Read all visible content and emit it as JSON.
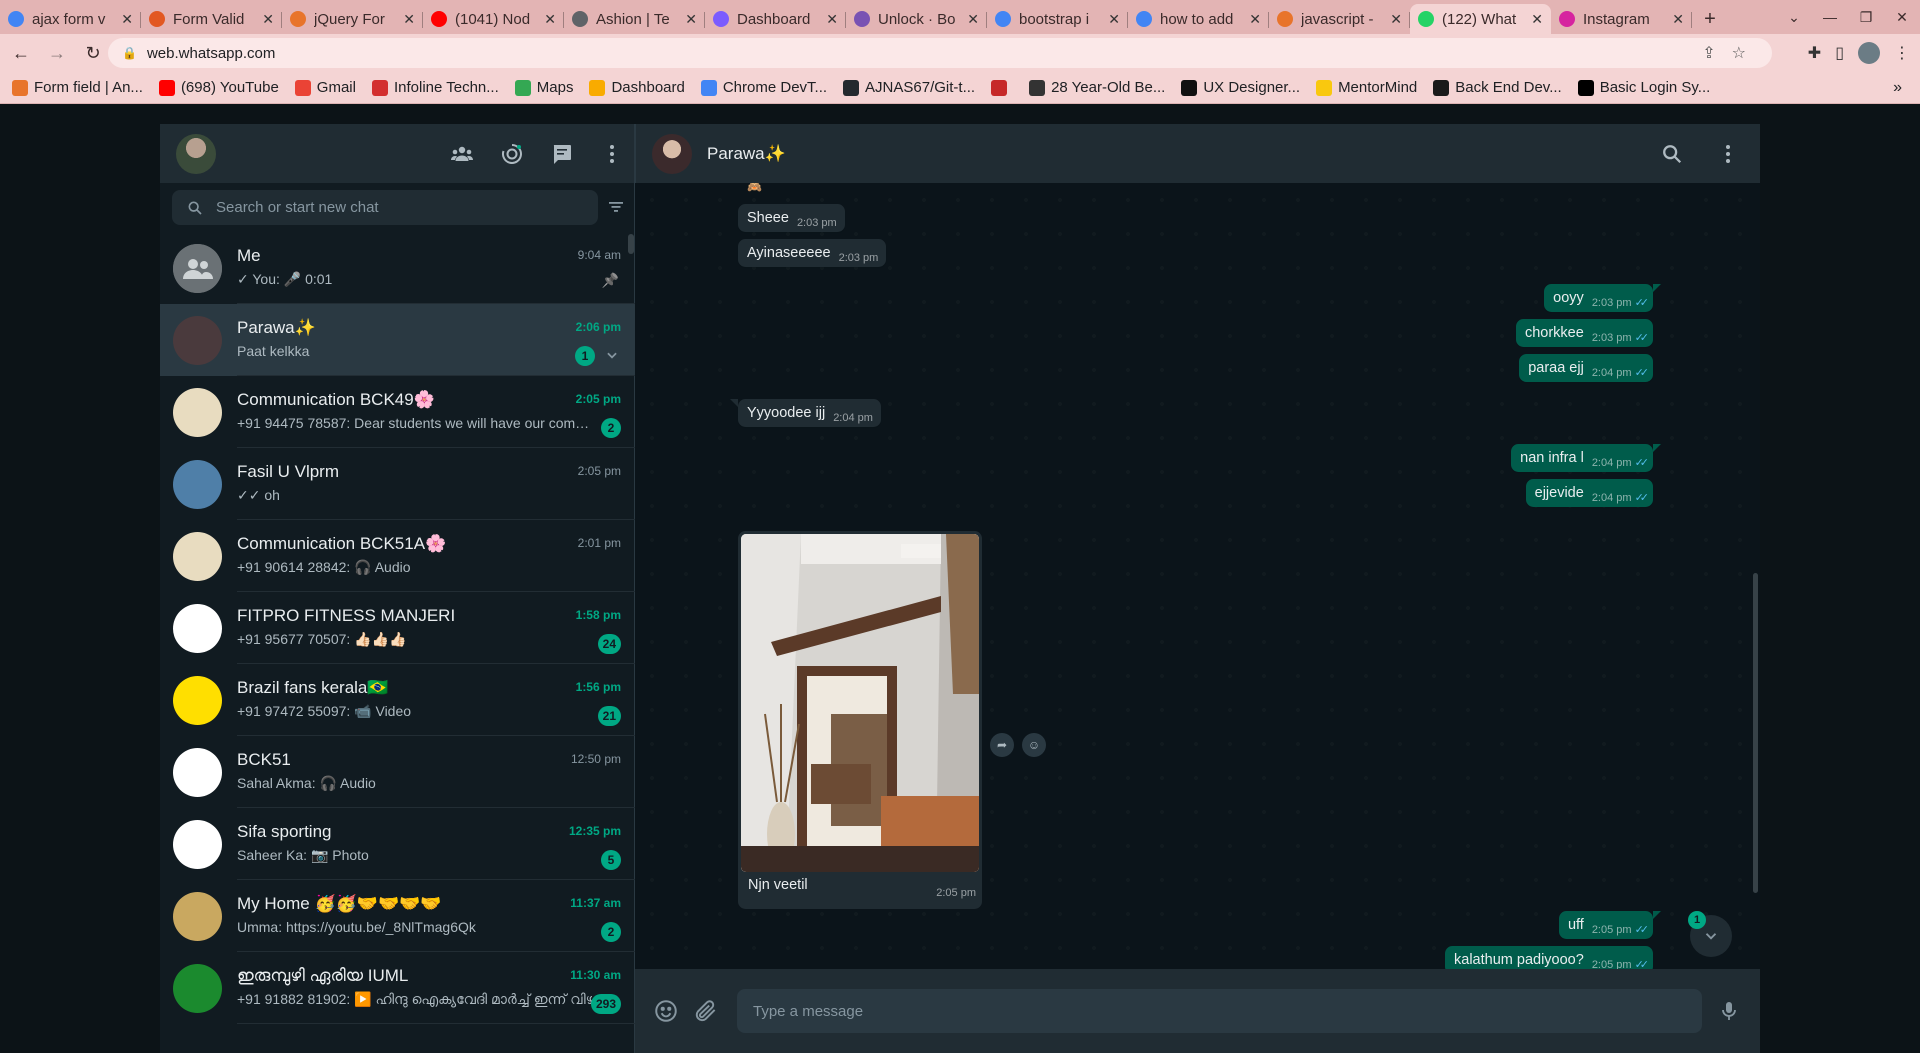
{
  "browser": {
    "tabs": [
      {
        "title": "ajax form v",
        "icon": "google-icon",
        "color": "#4285f4"
      },
      {
        "title": "Form Valid",
        "icon": "flame-icon",
        "color": "#e25822"
      },
      {
        "title": "jQuery For",
        "icon": "flame-icon",
        "color": "#e8742b"
      },
      {
        "title": "(1041) Nod",
        "icon": "youtube-icon",
        "color": "#ff0000"
      },
      {
        "title": "Ashion | Te",
        "icon": "globe-icon",
        "color": "#5f6368"
      },
      {
        "title": "Dashboard",
        "icon": "dashboard-icon",
        "color": "#7b5cff"
      },
      {
        "title": "Unlock · Bo",
        "icon": "bootstrap-icon",
        "color": "#7952b3"
      },
      {
        "title": "bootstrap i",
        "icon": "google-icon",
        "color": "#4285f4"
      },
      {
        "title": "how to add",
        "icon": "google-icon",
        "color": "#4285f4"
      },
      {
        "title": "javascript -",
        "icon": "flame-icon",
        "color": "#e8742b"
      },
      {
        "title": "(122) What",
        "icon": "whatsapp-icon",
        "color": "#25d366"
      },
      {
        "title": "Instagram",
        "icon": "instagram-icon",
        "color": "#d6249f"
      }
    ],
    "url": "web.whatsapp.com",
    "bookmarks": [
      {
        "label": "Form field | An...",
        "color": "#e8742b"
      },
      {
        "label": "(698) YouTube",
        "color": "#ff0000"
      },
      {
        "label": "Gmail",
        "color": "#ea4335"
      },
      {
        "label": "Infoline Techn...",
        "color": "#d32f2f"
      },
      {
        "label": "Maps",
        "color": "#34a853"
      },
      {
        "label": "Dashboard",
        "color": "#f9ab00"
      },
      {
        "label": "Chrome DevT...",
        "color": "#4285f4"
      },
      {
        "label": "AJNAS67/Git-t...",
        "color": "#24292e"
      },
      {
        "label": "",
        "color": "#c62828"
      },
      {
        "label": "28 Year-Old Be...",
        "color": "#333333"
      },
      {
        "label": "UX Designer...",
        "color": "#111111"
      },
      {
        "label": "MentorMind",
        "color": "#f9c80e"
      },
      {
        "label": "Back End Dev...",
        "color": "#1a1a1a"
      },
      {
        "label": "Basic Login Sy...",
        "color": "#000000"
      }
    ]
  },
  "sidebar": {
    "search_placeholder": "Search or start new chat",
    "chats": [
      {
        "name": "Me",
        "preview": "✓ You: 🎤 0:01",
        "time": "9:04 am",
        "unread": false,
        "badge": "",
        "pinned": true,
        "avatar": "#6a7175"
      },
      {
        "name": "Parawa✨",
        "preview": "Paat kelkka",
        "time": "2:06 pm",
        "unread": true,
        "badge": "1",
        "selected": true,
        "avatar": "#4a3a3d"
      },
      {
        "name": "Communication BCK49🌸",
        "preview": "+91 94475 78587: Dear students we will have our com…",
        "time": "2:05 pm",
        "unread": true,
        "badge": "2",
        "avatar": "#e8dcc0"
      },
      {
        "name": "Fasil  U Vlprm",
        "preview": "✓✓ oh",
        "time": "2:05 pm",
        "unread": false,
        "badge": "",
        "avatar": "#4f7fa8"
      },
      {
        "name": "Communication BCK51A🌸",
        "preview": "+91 90614 28842: 🎧 Audio",
        "time": "2:01 pm",
        "unread": false,
        "badge": "",
        "avatar": "#e8dcc0"
      },
      {
        "name": "FITPRO FITNESS MANJERI",
        "preview": "+91 95677 70507: 👍🏻👍🏻👍🏻",
        "time": "1:58 pm",
        "unread": true,
        "badge": "24",
        "avatar": "#ffffff"
      },
      {
        "name": "Brazil fans kerala🇧🇷",
        "preview": "+91 97472 55097: 📹 Video",
        "time": "1:56 pm",
        "unread": true,
        "badge": "21",
        "avatar": "#ffdf00"
      },
      {
        "name": "BCK51",
        "preview": "Sahal Akma: 🎧 Audio",
        "time": "12:50 pm",
        "unread": false,
        "badge": "",
        "avatar": "#ffffff"
      },
      {
        "name": "Sifa sporting",
        "preview": "Saheer Ka: 📷 Photo",
        "time": "12:35 pm",
        "unread": true,
        "badge": "5",
        "avatar": "#ffffff"
      },
      {
        "name": "My Home 🥳🥳🤝🤝🤝🤝",
        "preview": "Umma: https://youtu.be/_8NlTmag6Qk",
        "time": "11:37 am",
        "unread": true,
        "badge": "2",
        "avatar": "#c9a860"
      },
      {
        "name": "ഇരുമ്പുഴി ഏരിയ IUML",
        "preview": "+91 91882 81902: ▶️ ഹിന്ദു ഐക്യവേദി മാർച്ച് ഇന്ന് വിഴി…",
        "time": "11:30 am",
        "unread": true,
        "badge": "293",
        "avatar": "#1b8a2e"
      }
    ]
  },
  "conversation": {
    "name": "Parawa✨",
    "messages": [
      {
        "text": "Sheee",
        "time": "2:03 pm",
        "dir": "in"
      },
      {
        "text": "Ayinaseeeee",
        "time": "2:03 pm",
        "dir": "in"
      },
      {
        "text": "ooyy",
        "time": "2:03 pm",
        "dir": "out"
      },
      {
        "text": "chorkkee",
        "time": "2:03 pm",
        "dir": "out"
      },
      {
        "text": "paraa ejj",
        "time": "2:04 pm",
        "dir": "out"
      },
      {
        "text": "Yyyoodee ijj",
        "time": "2:04 pm",
        "dir": "in"
      },
      {
        "text": "nan infra l",
        "time": "2:04 pm",
        "dir": "out"
      },
      {
        "text": "ejjevide",
        "time": "2:04 pm",
        "dir": "out"
      },
      {
        "text": "uff",
        "time": "2:05 pm",
        "dir": "out"
      },
      {
        "text": "kalathum padiyooo?",
        "time": "2:05 pm",
        "dir": "out"
      }
    ],
    "image_message": {
      "caption": "Njn veetil",
      "time": "2:05 pm"
    },
    "scroll_badge": "1",
    "input_placeholder": "Type a message"
  },
  "colors": {
    "accent": "#00a884",
    "outgoing": "#005c4b",
    "incoming": "#202c33",
    "panel": "#111b21"
  }
}
